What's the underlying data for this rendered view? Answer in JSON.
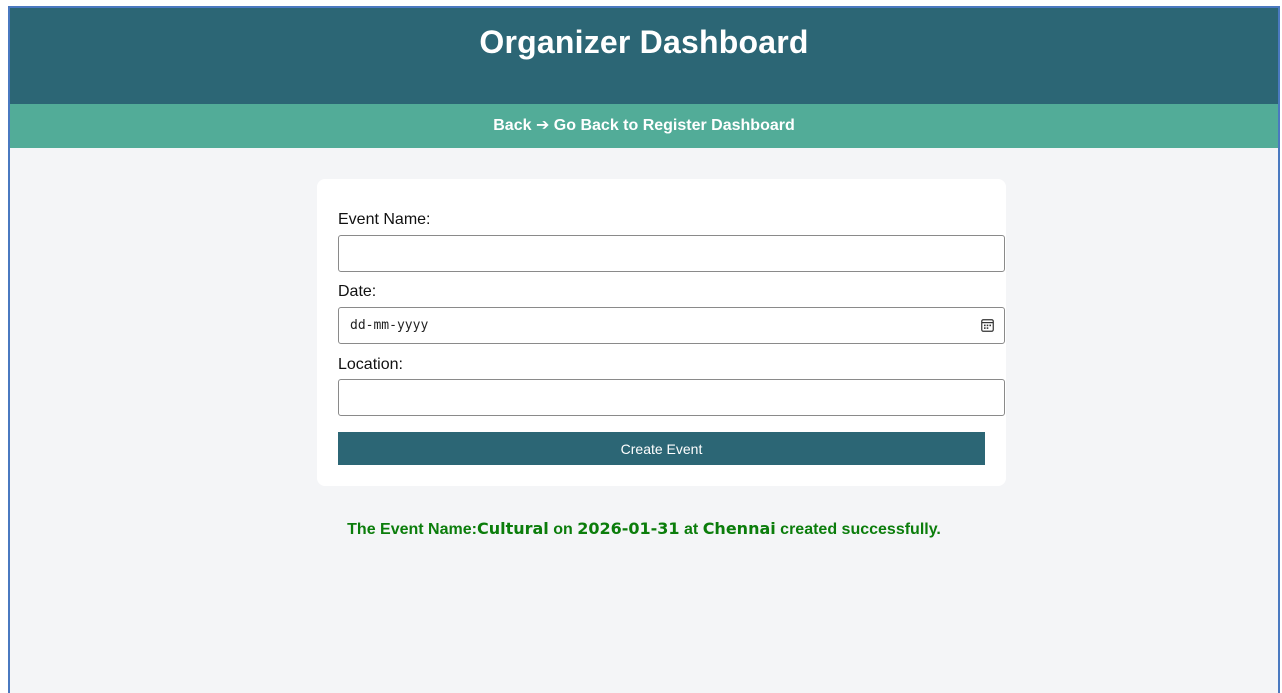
{
  "header": {
    "title": "Organizer Dashboard"
  },
  "nav": {
    "back_link": "Back ➔ Go Back to Register Dashboard"
  },
  "form": {
    "event_name": {
      "label": "Event Name:",
      "value": "",
      "placeholder": ""
    },
    "date": {
      "label": "Date:",
      "placeholder": "dd-mm-yyyy",
      "icon": "calendar-icon"
    },
    "location": {
      "label": "Location:",
      "value": "",
      "placeholder": ""
    },
    "submit_label": "Create Event"
  },
  "message": {
    "prefix": "The Event Name:",
    "event_name": "Cultural",
    "on_text": " on ",
    "date": "2026-01-31",
    "at_text": " at ",
    "location": "Chennai",
    "suffix": " created successfully."
  },
  "colors": {
    "header_bg": "#2c6675",
    "nav_bg": "#52ac98",
    "page_bg": "#f4f5f7",
    "button_bg": "#2c6675",
    "success_text": "#0b7d0b"
  }
}
